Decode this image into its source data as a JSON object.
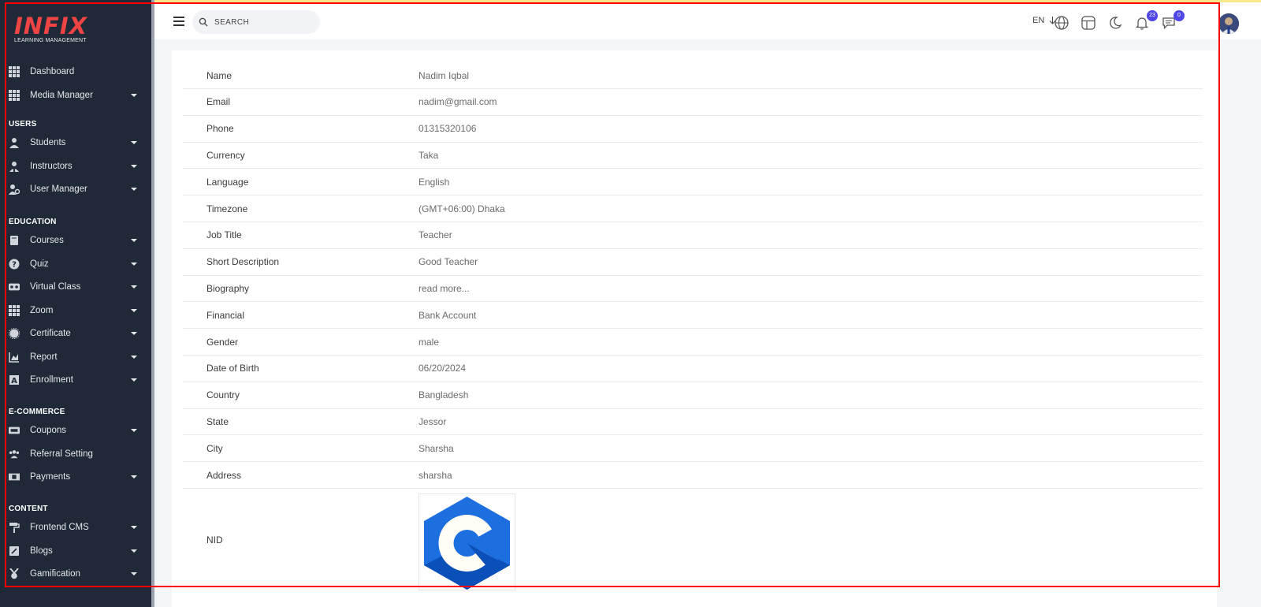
{
  "logo": {
    "brand": "INFIX",
    "tagline": "LEARNING MANAGEMENT"
  },
  "sidebar": {
    "items_top": [
      {
        "label": "Dashboard",
        "icon": "grid-icon",
        "caret": false
      },
      {
        "label": "Media Manager",
        "icon": "grid-icon",
        "caret": true
      }
    ],
    "sections": [
      {
        "title": "USERS",
        "items": [
          {
            "label": "Students",
            "icon": "user-icon",
            "caret": true
          },
          {
            "label": "Instructors",
            "icon": "instructor-icon",
            "caret": true
          },
          {
            "label": "User Manager",
            "icon": "user-gear-icon",
            "caret": true
          }
        ]
      },
      {
        "title": "EDUCATION",
        "items": [
          {
            "label": "Courses",
            "icon": "book-icon",
            "caret": true
          },
          {
            "label": "Quiz",
            "icon": "question-icon",
            "caret": true
          },
          {
            "label": "Virtual Class",
            "icon": "vr-icon",
            "caret": true
          },
          {
            "label": "Zoom",
            "icon": "grid-icon",
            "caret": true
          },
          {
            "label": "Certificate",
            "icon": "certificate-icon",
            "caret": true
          },
          {
            "label": "Report",
            "icon": "chart-icon",
            "caret": true
          },
          {
            "label": "Enrollment",
            "icon": "enrollment-icon",
            "caret": true
          }
        ]
      },
      {
        "title": "E-COMMERCE",
        "items": [
          {
            "label": "Coupons",
            "icon": "ticket-icon",
            "caret": true
          },
          {
            "label": "Referral Setting",
            "icon": "users-icon",
            "caret": false
          },
          {
            "label": "Payments",
            "icon": "money-icon",
            "caret": true
          }
        ]
      },
      {
        "title": "CONTENT",
        "items": [
          {
            "label": "Frontend CMS",
            "icon": "paint-roller-icon",
            "caret": true
          },
          {
            "label": "Blogs",
            "icon": "edit-icon",
            "caret": true
          },
          {
            "label": "Gamification",
            "icon": "medal-icon",
            "caret": true
          }
        ]
      }
    ]
  },
  "topbar": {
    "search_placeholder": "SEARCH",
    "language": "EN",
    "notification_count": "23",
    "message_count": "0"
  },
  "profile": {
    "fields": [
      {
        "label": "Name",
        "value": "Nadim Iqbal"
      },
      {
        "label": "Email",
        "value": "nadim@gmail.com"
      },
      {
        "label": "Phone",
        "value": "01315320106"
      },
      {
        "label": "Currency",
        "value": "Taka"
      },
      {
        "label": "Language",
        "value": "English"
      },
      {
        "label": "Timezone",
        "value": "(GMT+06:00) Dhaka"
      },
      {
        "label": "Job Title",
        "value": "Teacher"
      },
      {
        "label": "Short Description",
        "value": "Good Teacher"
      },
      {
        "label": "Biography",
        "value": "read more..."
      },
      {
        "label": "Financial",
        "value": "Bank Account"
      },
      {
        "label": "Gender",
        "value": "male"
      },
      {
        "label": "Date of Birth",
        "value": "06/20/2024"
      },
      {
        "label": "Country",
        "value": "Bangladesh"
      },
      {
        "label": "State",
        "value": "Jessor"
      },
      {
        "label": "City",
        "value": "Sharsha"
      },
      {
        "label": "Address",
        "value": "sharsha"
      }
    ],
    "nid_label": "NID"
  },
  "colors": {
    "sidebar_bg": "#1f2937",
    "brand_red": "#ef4444",
    "badge": "#4f46e5",
    "annotation_frame": "#ff0000"
  }
}
